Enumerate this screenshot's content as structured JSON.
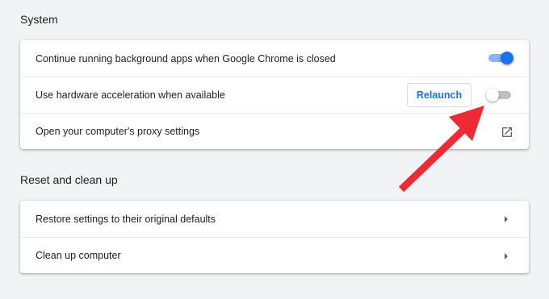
{
  "system": {
    "title": "System",
    "rows": [
      {
        "label": "Continue running background apps when Google Chrome is closed",
        "toggle": "on"
      },
      {
        "label": "Use hardware acceleration when available",
        "button_label": "Relaunch",
        "toggle": "off"
      },
      {
        "label": "Open your computer's proxy settings",
        "icon": "open-in-new-icon"
      }
    ]
  },
  "reset": {
    "title": "Reset and clean up",
    "rows": [
      {
        "label": "Restore settings to their original defaults",
        "icon": "arrow-right-icon"
      },
      {
        "label": "Clean up computer",
        "icon": "arrow-right-icon"
      }
    ]
  },
  "colors": {
    "accent": "#1a73e8",
    "annotation_arrow": "#ee2a34",
    "background": "#f1f3f4"
  }
}
